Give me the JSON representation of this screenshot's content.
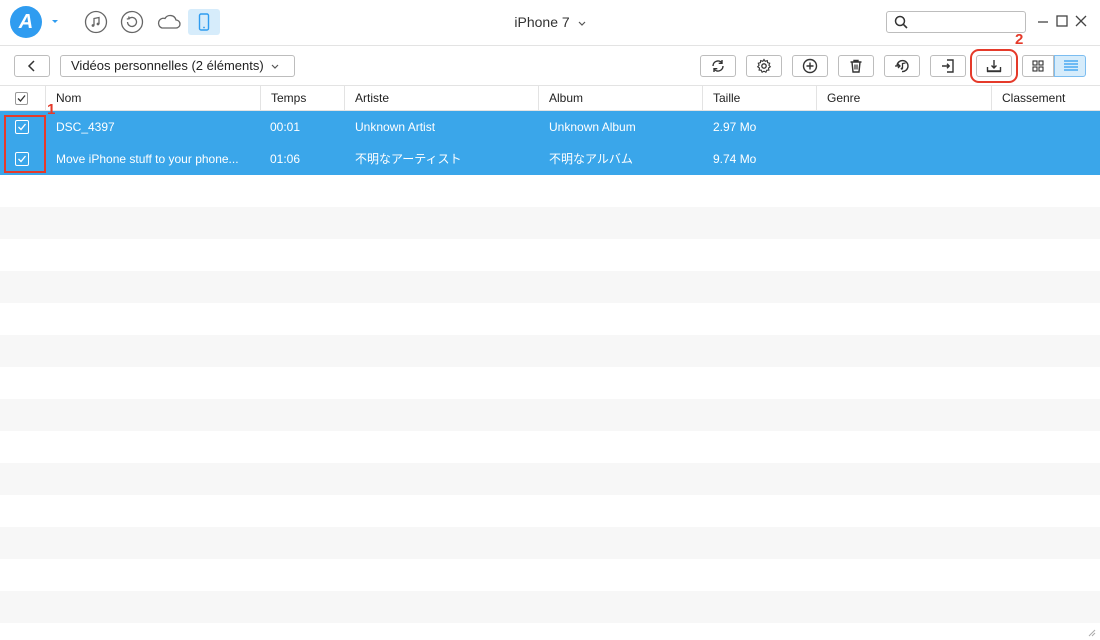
{
  "header": {
    "device_name": "iPhone 7",
    "search_placeholder": ""
  },
  "icons": {
    "logo": "anytrans-logo-icon",
    "music": "music-note-icon",
    "history": "history-icon",
    "cloud": "cloud-icon",
    "device": "phone-icon",
    "search": "search-icon"
  },
  "toolbar": {
    "category_label": "Vidéos personnelles (2 éléments)",
    "buttons": [
      "refresh-icon",
      "settings-icon",
      "add-icon",
      "delete-icon",
      "to-itunes-icon",
      "to-device-icon",
      "to-computer-icon"
    ]
  },
  "annotations": {
    "first": "1",
    "second": "2"
  },
  "table": {
    "columns": [
      "Nom",
      "Temps",
      "Artiste",
      "Album",
      "Taille",
      "Genre",
      "Classement"
    ],
    "rows": [
      {
        "name": "DSC_4397",
        "time": "00:01",
        "artist": "Unknown Artist",
        "album": "Unknown Album",
        "size": "2.97 Mo",
        "genre": "",
        "rating": ""
      },
      {
        "name": "Move iPhone stuff to your phone...",
        "time": "01:06",
        "artist": "不明なアーティスト",
        "album": "不明なアルバム",
        "size": "9.74 Mo",
        "genre": "",
        "rating": ""
      }
    ]
  },
  "colors": {
    "accent": "#2f9cf0",
    "selected_row": "#3aa6ea",
    "annotation": "#e53a2a"
  }
}
